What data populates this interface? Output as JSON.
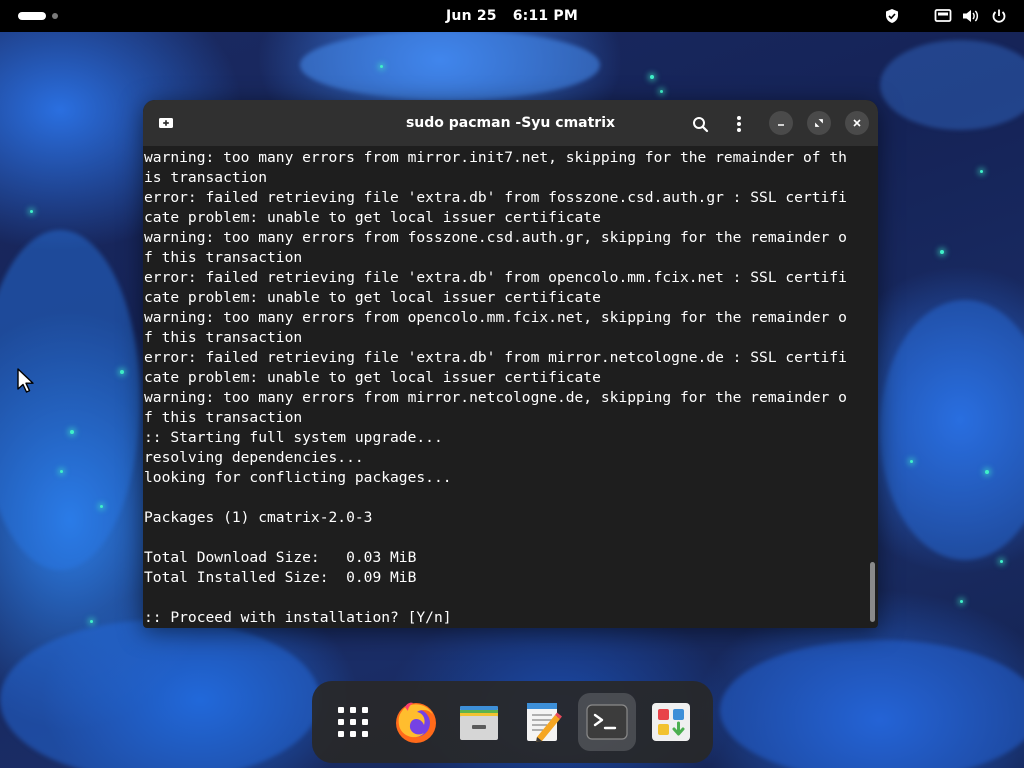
{
  "topbar": {
    "date": "Jun 25",
    "time": "6:11 PM",
    "tray_icons": [
      "shield-icon",
      "network-icon",
      "volume-icon",
      "power-icon"
    ]
  },
  "terminal": {
    "title": "sudo pacman -Syu cmatrix",
    "lines": [
      "warning: too many errors from mirror.init7.net, skipping for the remainder of th",
      "is transaction",
      "error: failed retrieving file 'extra.db' from fosszone.csd.auth.gr : SSL certifi",
      "cate problem: unable to get local issuer certificate",
      "warning: too many errors from fosszone.csd.auth.gr, skipping for the remainder o",
      "f this transaction",
      "error: failed retrieving file 'extra.db' from opencolo.mm.fcix.net : SSL certifi",
      "cate problem: unable to get local issuer certificate",
      "warning: too many errors from opencolo.mm.fcix.net, skipping for the remainder o",
      "f this transaction",
      "error: failed retrieving file 'extra.db' from mirror.netcologne.de : SSL certifi",
      "cate problem: unable to get local issuer certificate",
      "warning: too many errors from mirror.netcologne.de, skipping for the remainder o",
      "f this transaction",
      ":: Starting full system upgrade...",
      "resolving dependencies...",
      "looking for conflicting packages...",
      "",
      "Packages (1) cmatrix-2.0-3",
      "",
      "Total Download Size:   0.03 MiB",
      "Total Installed Size:  0.09 MiB",
      "",
      ":: Proceed with installation? [Y/n]"
    ],
    "buttons": [
      "new-tab-icon",
      "search-icon",
      "menu-icon",
      "minimize-icon",
      "maximize-icon",
      "close-icon"
    ]
  },
  "dock": {
    "items": [
      "app-grid-icon",
      "firefox-icon",
      "files-icon",
      "text-editor-icon",
      "terminal-icon",
      "software-icon"
    ],
    "active": "terminal-icon"
  },
  "colors": {
    "terminal_bg": "#1e1e1e",
    "titlebar_bg": "#303030",
    "topbar_bg": "#000000",
    "text": "#ffffff"
  }
}
